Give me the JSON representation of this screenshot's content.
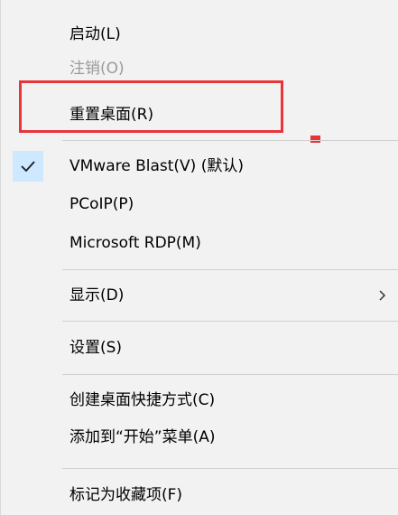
{
  "menu": {
    "items": [
      {
        "label": "启动(L)"
      },
      {
        "label": "注销(O)"
      },
      {
        "label": "重置桌面(R)"
      },
      {
        "label": "VMware Blast(V) (默认)"
      },
      {
        "label": "PCoIP(P)"
      },
      {
        "label": "Microsoft RDP(M)"
      },
      {
        "label": "显示(D)"
      },
      {
        "label": "设置(S)"
      },
      {
        "label": "创建桌面快捷方式(C)"
      },
      {
        "label": "添加到“开始”菜单(A)"
      },
      {
        "label": "标记为收藏项(F)"
      }
    ]
  },
  "icons": {
    "checked": "checkmark-icon",
    "submenu": "chevron-right-icon"
  },
  "colors": {
    "menu_background": "#f2f2f2",
    "check_background": "#cde8ff",
    "disabled_text": "#9a9a9a",
    "annotation_red": "#e8353a"
  }
}
